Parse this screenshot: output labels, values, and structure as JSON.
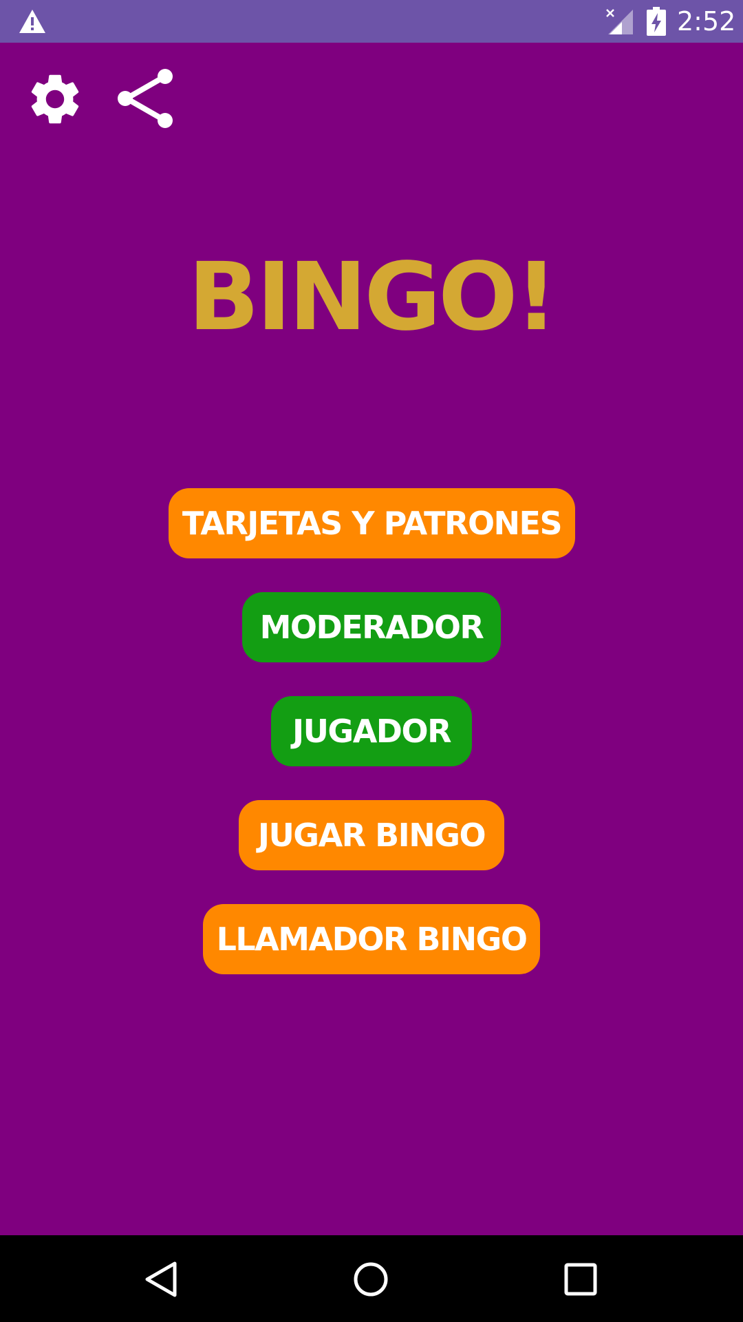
{
  "status_bar": {
    "time": "2:52",
    "icons": [
      "warning-icon",
      "signal-icon",
      "battery-charging-icon"
    ],
    "color": "#6d54a8"
  },
  "toolbar": {
    "icons": [
      "gear-icon",
      "share-icon"
    ]
  },
  "app": {
    "title": "BINGO!",
    "title_color": "#d4a833",
    "background_color": "#7f007f"
  },
  "menu": {
    "buttons": [
      {
        "label": "TARJETAS Y PATRONES",
        "color": "#ff8800"
      },
      {
        "label": "MODERADOR",
        "color": "#139e13"
      },
      {
        "label": "JUGADOR",
        "color": "#139e13"
      },
      {
        "label": "JUGAR BINGO",
        "color": "#ff8800"
      },
      {
        "label": "LLAMADOR BINGO",
        "color": "#ff8800"
      }
    ]
  },
  "nav_bar": {
    "icons": [
      "back-icon",
      "home-icon",
      "recents-icon"
    ]
  }
}
